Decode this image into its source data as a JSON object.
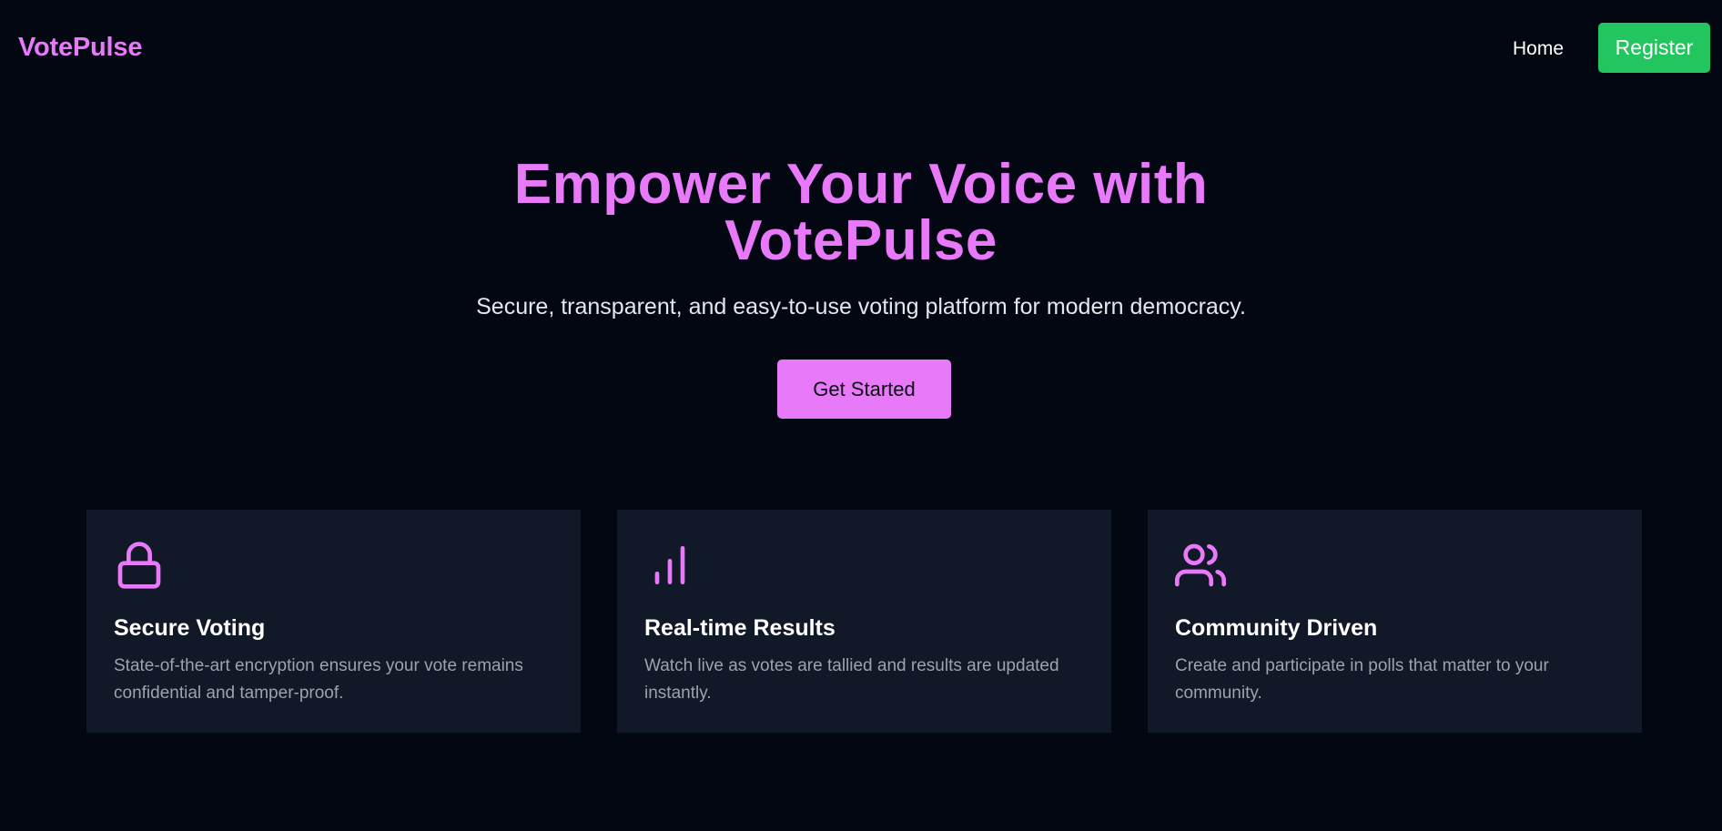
{
  "colors": {
    "accent": "#e879f9",
    "register_bg": "#22c55e",
    "background": "#030712",
    "card_bg": "#111827",
    "muted_text": "#9ca3af"
  },
  "nav": {
    "logo": "VotePulse",
    "home_label": "Home",
    "register_label": "Register"
  },
  "hero": {
    "title_line1": "Empower Your Voice with",
    "title_line2": "VotePulse",
    "subtitle": "Secure, transparent, and easy-to-use voting platform for modern democracy.",
    "cta_label": "Get Started"
  },
  "features": [
    {
      "icon": "lock-icon",
      "title": "Secure Voting",
      "description": "State-of-the-art encryption ensures your vote remains confidential and tamper-proof."
    },
    {
      "icon": "bar-chart-icon",
      "title": "Real-time Results",
      "description": "Watch live as votes are tallied and results are updated instantly."
    },
    {
      "icon": "users-icon",
      "title": "Community Driven",
      "description": "Create and participate in polls that matter to your community."
    }
  ]
}
